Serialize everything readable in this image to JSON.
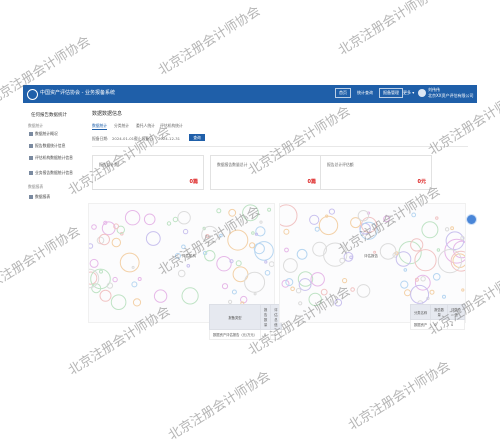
{
  "header": {
    "title": "中国资产评估协会 - 业务报备系统",
    "nav_home": "首页",
    "nav_stats": "统计查询",
    "nav_report": "报备管理",
    "nav_more": "更多 ▾",
    "user_name": "刘伟伟",
    "user_org": "北京XX资产评估有限公司"
  },
  "sidebar": {
    "header": "任何报告数据统计",
    "group1": "数据统计",
    "items": [
      "数据统计概况",
      "报告数据统计信息",
      "评估机构数据统计信息",
      "业务报告数据统计信息"
    ],
    "group2": "数据报表",
    "items2": [
      "数据报表"
    ]
  },
  "main": {
    "title": "数据数据信息",
    "tabs": [
      "数据统计",
      "分类统计",
      "委托人统计",
      "评估机构统计"
    ],
    "filter_start_label": "报备日期:",
    "filter_start_value": "2024-01-01",
    "filter_end_label": "截止报备日:",
    "filter_end_value": "2024-12-31",
    "query_button": "查询",
    "cards": [
      {
        "label": "报告总计数",
        "value": "0篇"
      },
      {
        "label": "数据报告数量总计",
        "value": "0篇"
      },
      {
        "label": "报告总计评估额",
        "value": "0元"
      }
    ],
    "chart_left_tag": "评估机构",
    "chart_right_tag": "评估报告",
    "table_left": {
      "headers": [
        "报备类型",
        "报告数量",
        "评估总值"
      ],
      "row": [
        "数据资产评估报告（元/万元）",
        "0",
        "0"
      ]
    },
    "table_right": {
      "headers": [
        "分类名称",
        "报告数量",
        "评估总值"
      ],
      "row": [
        "数据资产",
        "0",
        "0"
      ]
    }
  },
  "watermark": {
    "text": "北京注册会计师协会"
  }
}
